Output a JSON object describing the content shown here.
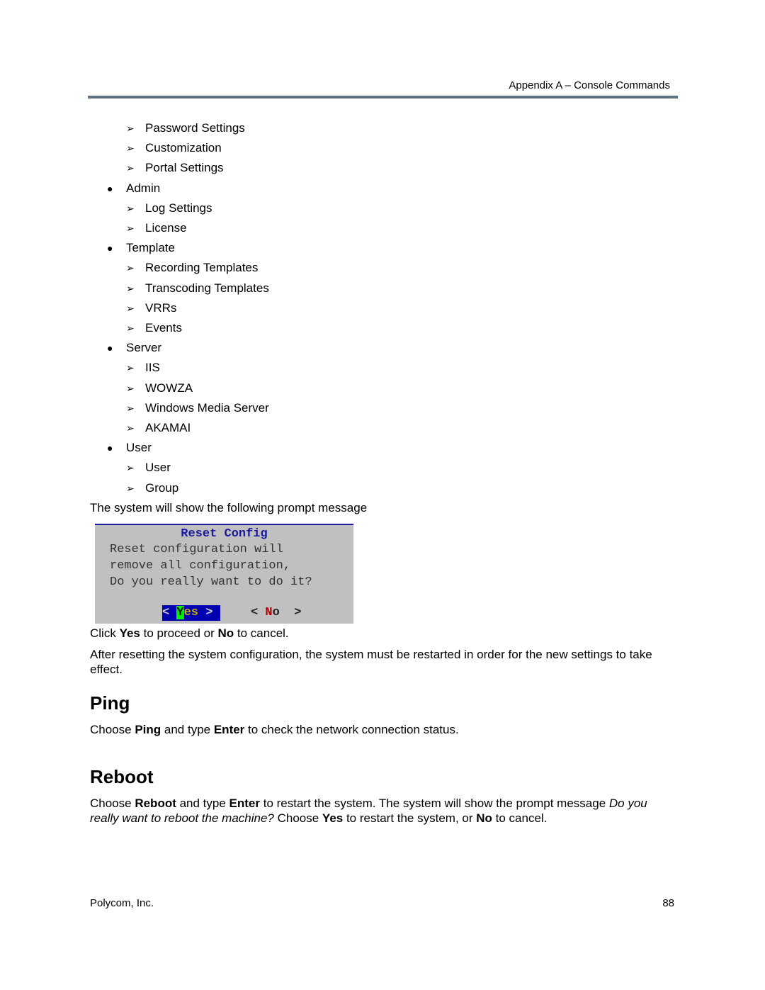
{
  "header": {
    "title": "Appendix A – Console Commands",
    "rule_color": "#5f7480"
  },
  "list": [
    {
      "level": 2,
      "text": "Password Settings"
    },
    {
      "level": 2,
      "text": "Customization"
    },
    {
      "level": 2,
      "text": "Portal Settings"
    },
    {
      "level": 1,
      "text": "Admin"
    },
    {
      "level": 2,
      "text": "Log Settings"
    },
    {
      "level": 2,
      "text": "License"
    },
    {
      "level": 1,
      "text": "Template"
    },
    {
      "level": 2,
      "text": "Recording Templates"
    },
    {
      "level": 2,
      "text": "Transcoding Templates"
    },
    {
      "level": 2,
      "text": "VRRs"
    },
    {
      "level": 2,
      "text": "Events"
    },
    {
      "level": 1,
      "text": "Server"
    },
    {
      "level": 2,
      "text": "IIS"
    },
    {
      "level": 2,
      "text": "WOWZA"
    },
    {
      "level": 2,
      "text": "Windows Media Server"
    },
    {
      "level": 2,
      "text": "AKAMAI"
    },
    {
      "level": 1,
      "text": "User"
    },
    {
      "level": 2,
      "text": "User"
    },
    {
      "level": 2,
      "text": "Group"
    }
  ],
  "bullets": {
    "level1": "●",
    "level2": "➢"
  },
  "prompt_intro": "The system will show the following prompt message",
  "dialog": {
    "title": "Reset Config",
    "lines": [
      "Reset configuration will",
      "remove all configuration,",
      "Do you really want to do it?"
    ],
    "yes": {
      "open": "< ",
      "hot": "Y",
      "rest": "es",
      "close": " >"
    },
    "no": {
      "open": "< ",
      "hot": "N",
      "rest": "o",
      "close": "  >"
    },
    "colors": {
      "background": "#c0c0c0",
      "title": "#1a1aa0",
      "yes_bg": "#0000b0",
      "yes_hot": "#00ee00",
      "no_hot": "#b00000"
    }
  },
  "click_line": {
    "a": "Click ",
    "b1": "Yes",
    "c": " to proceed or ",
    "b2": "No",
    "d": " to cancel."
  },
  "after_reset": "After resetting the system configuration, the system must be restarted in order for the new settings to take effect.",
  "ping": {
    "heading": "Ping",
    "p": {
      "a": "Choose ",
      "b1": "Ping",
      "c": " and type ",
      "b2": "Enter",
      "d": " to check the network connection status."
    }
  },
  "reboot": {
    "heading": "Reboot",
    "p": {
      "a": "Choose ",
      "b1": "Reboot",
      "c": " and type ",
      "b2": "Enter",
      "d": " to restart the system. The system will show the prompt message ",
      "i": "Do you really want to reboot the machine?",
      "e": " Choose ",
      "b3": "Yes",
      "f": " to restart the system, or ",
      "b4": "No",
      "g": " to cancel."
    }
  },
  "footer": {
    "company": "Polycom, Inc.",
    "page": "88"
  }
}
